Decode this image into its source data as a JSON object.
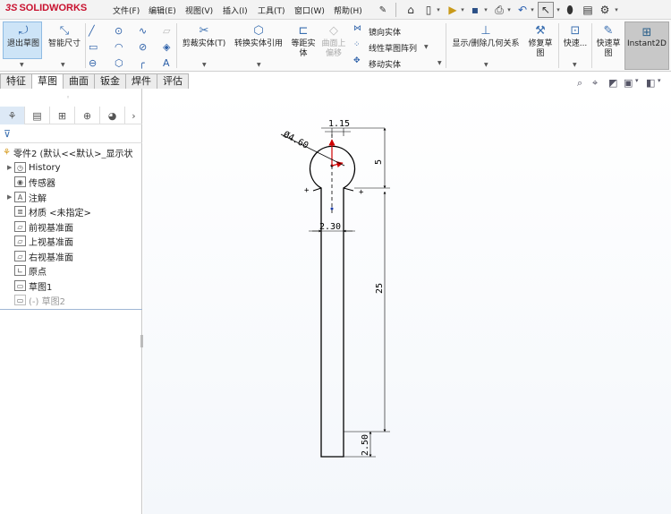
{
  "app": {
    "logo": "SOLIDWORKS"
  },
  "menu": [
    "文件(F)",
    "编辑(E)",
    "视图(V)",
    "插入(I)",
    "工具(T)",
    "窗口(W)",
    "帮助(H)"
  ],
  "quick_access": [
    "home-icon",
    "new-doc-icon",
    "open-icon",
    "save-icon",
    "print-icon",
    "undo-icon",
    "select-icon",
    "traffic-light-icon",
    "file-props-icon",
    "options-gear-icon"
  ],
  "commands": {
    "exit_sketch": "退出草图",
    "smart_dim": "智能尺寸",
    "trim": "剪裁实体(T)",
    "convert": "转换实体引用",
    "offset": "等距实体",
    "offset_surface": "曲面上偏移",
    "mirror": "镜向实体",
    "linear_pattern": "线性草图阵列",
    "move": "移动实体",
    "relations": "显示/删除几何关系",
    "repair": "修复草图",
    "quick_snap": "快速...",
    "quick_sketch": "快速草图",
    "instant2d": "Instant2D"
  },
  "tabs": [
    "特征",
    "草图",
    "曲面",
    "钣金",
    "焊件",
    "评估"
  ],
  "active_tab": "草图",
  "tree": {
    "root": "零件2 (默认<<默认>_显示状",
    "items": [
      {
        "label": "History",
        "icon": "history-icon",
        "arrow": true
      },
      {
        "label": "传感器",
        "icon": "sensor-icon",
        "arrow": false
      },
      {
        "label": "注解",
        "icon": "annotation-icon",
        "arrow": true
      },
      {
        "label": "材质 <未指定>",
        "icon": "material-icon",
        "arrow": false
      },
      {
        "label": "前视基准面",
        "icon": "plane-icon",
        "arrow": false
      },
      {
        "label": "上视基准面",
        "icon": "plane-icon",
        "arrow": false
      },
      {
        "label": "右视基准面",
        "icon": "plane-icon",
        "arrow": false
      },
      {
        "label": "原点",
        "icon": "origin-icon",
        "arrow": false
      },
      {
        "label": "草图1",
        "icon": "sketch-icon",
        "arrow": false
      },
      {
        "label": "(-) 草图2",
        "icon": "sketch-icon",
        "arrow": false
      }
    ]
  },
  "sketch": {
    "dim_circle": "Ø4.60",
    "dim_top": "1.15",
    "dim_height_circle": "5",
    "dim_width": "2.30",
    "dim_length": "25",
    "dim_bottom": "2.50"
  },
  "colors": {
    "accent": "#3a6fb0",
    "brand": "#c8102e",
    "dim_arrow": "#d00000",
    "sketch_line": "#000000"
  }
}
